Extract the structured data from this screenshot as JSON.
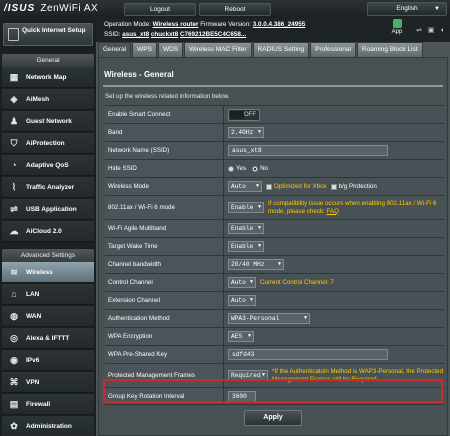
{
  "header": {
    "brand": "/ISUS",
    "product": "ZenWiFi AX",
    "logout_label": "Logout",
    "reboot_label": "Reboot",
    "language": "English"
  },
  "info": {
    "op_mode_label": "Operation Mode:",
    "op_mode_value": "Wireless router",
    "fw_label": "Firmware Version:",
    "fw_value": "3.0.0.4.386_24955",
    "ssid_label": "SSID:",
    "ssid_1": "asus_xt8",
    "ssid_2": "chuckxt8",
    "ssid_3": "C769212BE5C4C658...",
    "app_label": "App"
  },
  "sidebar": {
    "qis_label": "Quick Internet Setup",
    "general_title": "General",
    "general_items": [
      {
        "label": "Network Map",
        "icon": "network-map-icon",
        "glyph": "▦"
      },
      {
        "label": "AiMesh",
        "icon": "aimesh-icon",
        "glyph": "◈"
      },
      {
        "label": "Guest Network",
        "icon": "guest-network-icon",
        "glyph": "♟"
      },
      {
        "label": "AiProtection",
        "icon": "shield-icon",
        "glyph": "⛉"
      },
      {
        "label": "Adaptive QoS",
        "icon": "qos-gauge-icon",
        "glyph": "◔"
      },
      {
        "label": "Traffic Analyzer",
        "icon": "traffic-analyzer-icon",
        "glyph": "⌇"
      },
      {
        "label": "USB Application",
        "icon": "usb-icon",
        "glyph": "⇌"
      },
      {
        "label": "AiCloud 2.0",
        "icon": "cloud-icon",
        "glyph": "☁"
      }
    ],
    "advanced_title": "Advanced Settings",
    "advanced_items": [
      {
        "label": "Wireless",
        "icon": "wireless-icon",
        "glyph": "≋"
      },
      {
        "label": "LAN",
        "icon": "lan-icon",
        "glyph": "⌂"
      },
      {
        "label": "WAN",
        "icon": "globe-icon",
        "glyph": "◍"
      },
      {
        "label": "Alexa & IFTTT",
        "icon": "alexa-icon",
        "glyph": "◎"
      },
      {
        "label": "IPv6",
        "icon": "ipv6-icon",
        "glyph": "◉"
      },
      {
        "label": "VPN",
        "icon": "vpn-icon",
        "glyph": "⌘"
      },
      {
        "label": "Firewall",
        "icon": "firewall-icon",
        "glyph": "▤"
      },
      {
        "label": "Administration",
        "icon": "admin-icon",
        "glyph": "✿"
      }
    ]
  },
  "tabs": [
    "General",
    "WPS",
    "WDS",
    "Wireless MAC Filter",
    "RADIUS Setting",
    "Professional",
    "Roaming Block List"
  ],
  "panel": {
    "title": "Wireless - General",
    "description": "Set up the wireless related information below.",
    "rows": {
      "smart_connect": {
        "label": "Enable Smart Connect",
        "value": "OFF"
      },
      "band": {
        "label": "Band",
        "value": "2.4GHz"
      },
      "ssid": {
        "label": "Network Name (SSID)",
        "value": "asus_xt8"
      },
      "hide_ssid": {
        "label": "Hide SSID",
        "yes": "Yes",
        "no": "No"
      },
      "wireless_mode": {
        "label": "Wireless Mode",
        "value": "Auto",
        "opt1": "Optimized for Xbox",
        "opt2": "b/g Protection"
      },
      "ax_mode": {
        "label": "802.11ax / Wi-Fi 6 mode",
        "value": "Enable",
        "note": "If compatibility issue occurs when enabling 802.11ax / Wi-Fi 6 mode, please check:",
        "link": "FAQ"
      },
      "agile_multiband": {
        "label": "Wi-Fi Agile Multiband",
        "value": "Enable"
      },
      "twt": {
        "label": "Target Wake Time",
        "value": "Enable"
      },
      "bandwidth": {
        "label": "Channel bandwidth",
        "value": "20/40 MHz"
      },
      "control_channel": {
        "label": "Control Channel",
        "value": "Auto",
        "note": "Current Control Channel: 7"
      },
      "ext_channel": {
        "label": "Extension Channel",
        "value": "Auto"
      },
      "auth_method": {
        "label": "Authentication Method",
        "value": "WPA3-Personal"
      },
      "wpa_encryption": {
        "label": "WPA Encryption",
        "value": "AES"
      },
      "psk": {
        "label": "WPA Pre-Shared Key",
        "value": "sdfd43"
      },
      "pmf": {
        "label": "Protected Management Frames",
        "value": "Required",
        "note": "*If the Authenticatoin Method is WAP3-Personal, the Protected Management Frames will be Required."
      },
      "rekey": {
        "label": "Group Key Rotation Interval",
        "value": "3600"
      }
    },
    "apply_label": "Apply"
  }
}
